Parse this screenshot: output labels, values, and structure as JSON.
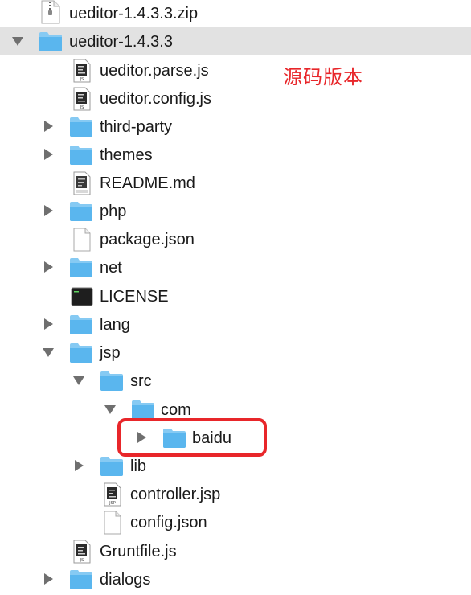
{
  "annotation": {
    "text": "源码版本",
    "color": "#e8262a"
  },
  "colors": {
    "folder": "#5ab6ee",
    "folder_tab": "#86caf3",
    "selection": "#e2e2e2",
    "highlight": "#e8262a"
  },
  "rows": [
    {
      "label": "ueditor-1.4.3.3.zip",
      "icon": "zip-file-icon",
      "expanded": null
    },
    {
      "label": "ueditor-1.4.3.3",
      "icon": "folder-icon",
      "expanded": true,
      "selected": true
    },
    {
      "label": "ueditor.parse.js",
      "icon": "js-file-icon",
      "expanded": null
    },
    {
      "label": "ueditor.config.js",
      "icon": "js-file-icon",
      "expanded": null
    },
    {
      "label": "third-party",
      "icon": "folder-icon",
      "expanded": false
    },
    {
      "label": "themes",
      "icon": "folder-icon",
      "expanded": false
    },
    {
      "label": "README.md",
      "icon": "markdown-file-icon",
      "expanded": null
    },
    {
      "label": "php",
      "icon": "folder-icon",
      "expanded": false
    },
    {
      "label": "package.json",
      "icon": "blank-file-icon",
      "expanded": null
    },
    {
      "label": "net",
      "icon": "folder-icon",
      "expanded": false
    },
    {
      "label": "LICENSE",
      "icon": "terminal-file-icon",
      "expanded": null
    },
    {
      "label": "lang",
      "icon": "folder-icon",
      "expanded": false
    },
    {
      "label": "jsp",
      "icon": "folder-icon",
      "expanded": true
    },
    {
      "label": "src",
      "icon": "folder-icon",
      "expanded": true
    },
    {
      "label": "com",
      "icon": "folder-icon",
      "expanded": true
    },
    {
      "label": "baidu",
      "icon": "folder-icon",
      "expanded": false,
      "highlighted": true
    },
    {
      "label": "lib",
      "icon": "folder-icon",
      "expanded": false
    },
    {
      "label": "controller.jsp",
      "icon": "jsp-file-icon",
      "expanded": null
    },
    {
      "label": "config.json",
      "icon": "blank-file-icon",
      "expanded": null
    },
    {
      "label": "Gruntfile.js",
      "icon": "js-file-icon",
      "expanded": null
    },
    {
      "label": "dialogs",
      "icon": "folder-icon",
      "expanded": false
    }
  ]
}
